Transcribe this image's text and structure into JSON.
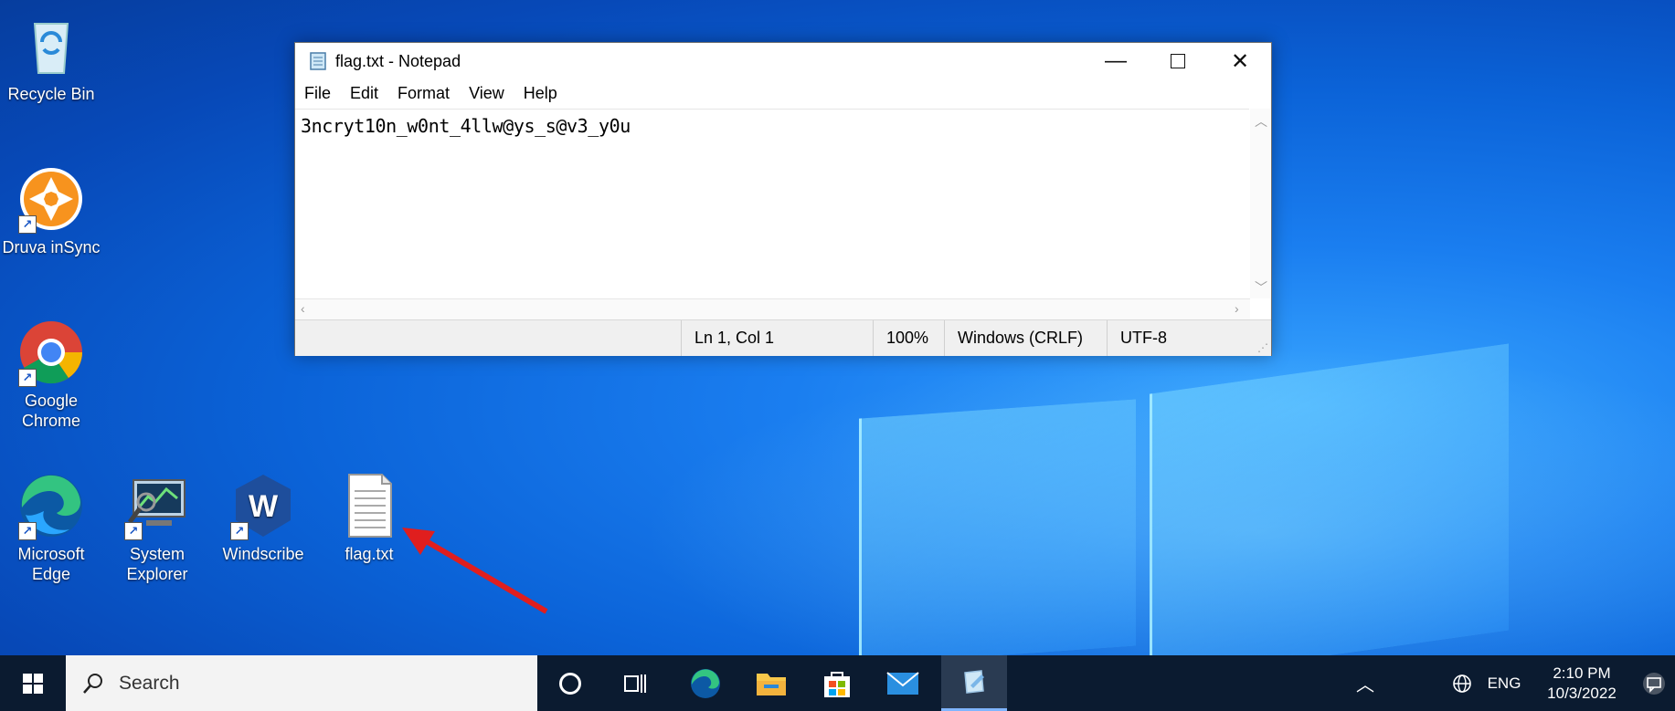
{
  "desktop": {
    "icons": [
      {
        "label": "Recycle Bin"
      },
      {
        "label": "Druva inSync"
      },
      {
        "label": "Google Chrome"
      },
      {
        "label": "Microsoft Edge"
      },
      {
        "label": "System Explorer"
      },
      {
        "label": "Windscribe"
      },
      {
        "label": "flag.txt"
      }
    ]
  },
  "notepad": {
    "title": "flag.txt - Notepad",
    "menu": [
      "File",
      "Edit",
      "Format",
      "View",
      "Help"
    ],
    "content": "3ncryt10n_w0nt_4llw@ys_s@v3_y0u",
    "status": {
      "position": "Ln 1, Col 1",
      "zoom": "100%",
      "line_ending": "Windows (CRLF)",
      "encoding": "UTF-8"
    }
  },
  "taskbar": {
    "search_placeholder": "Search",
    "tray": {
      "language": "ENG",
      "time": "2:10 PM",
      "date": "10/3/2022"
    }
  },
  "colors": {
    "desktop_blue": "#0b63d8",
    "taskbar": "#0b1b30",
    "annotation_arrow": "#e01e1e"
  }
}
